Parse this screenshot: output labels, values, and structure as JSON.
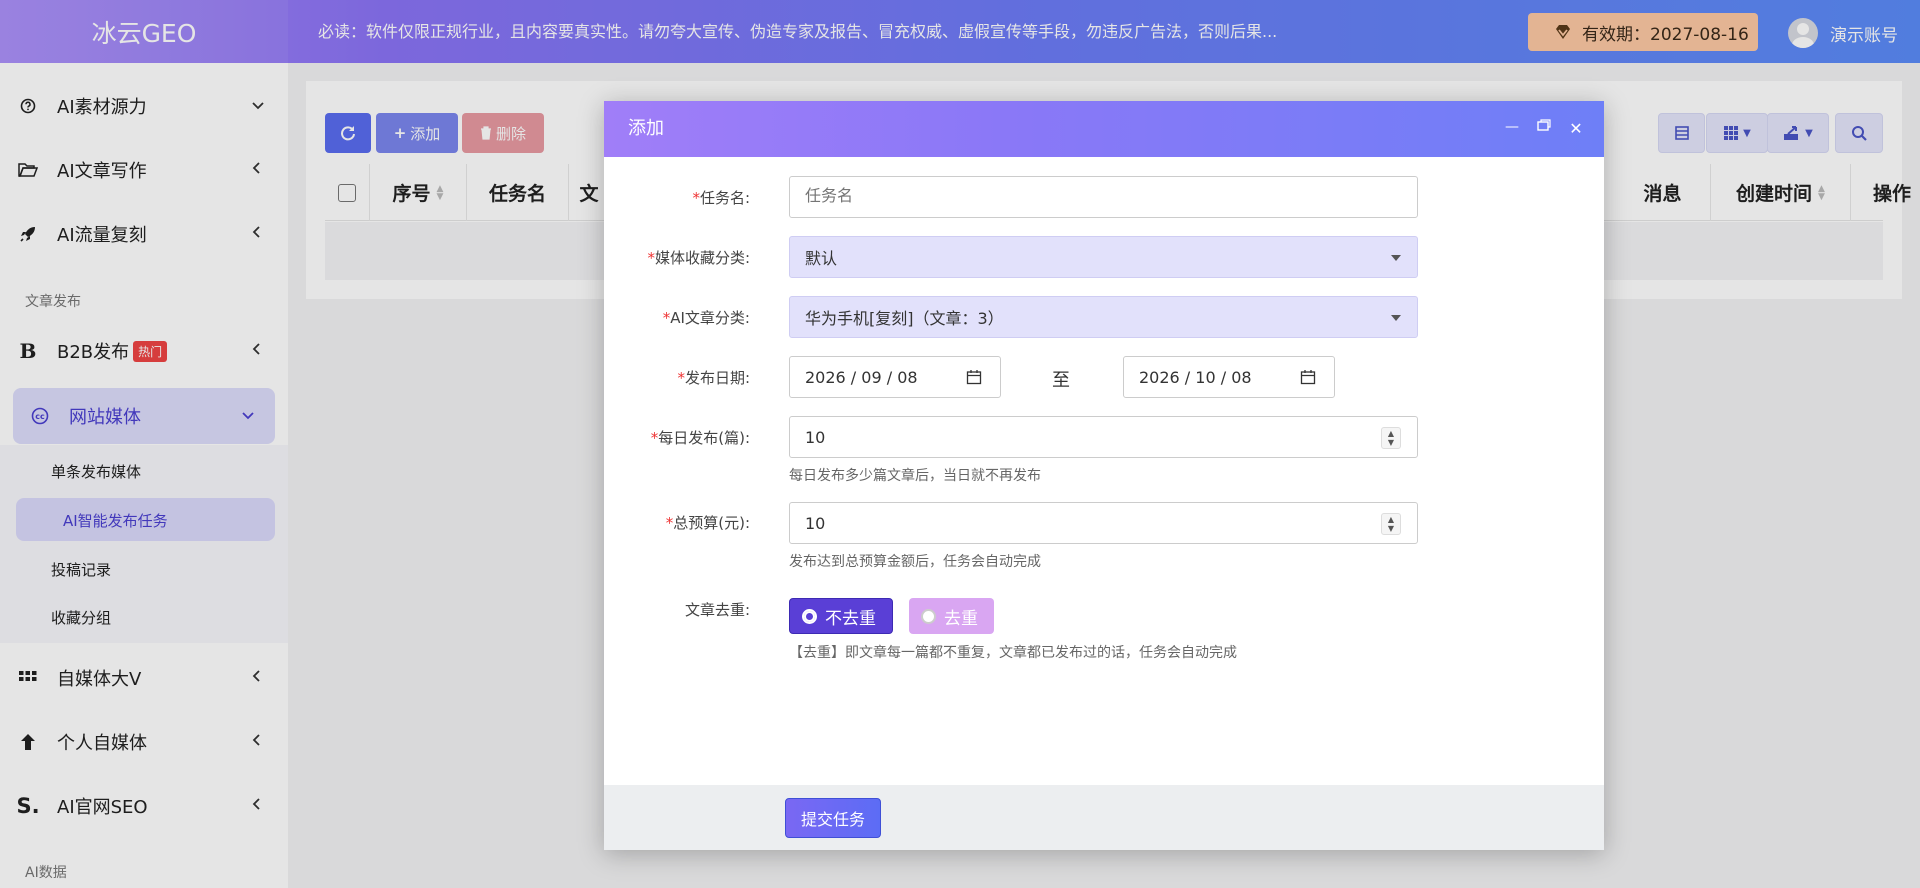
{
  "app": {
    "logo": "冰云GEO",
    "notice": "必读：软件仅限正规行业，且内容要真实性。请勿夸大宣传、伪造专家及报告、冒充权威、虚假宣传等手段，勿违反广告法，否则后果...",
    "expiry": "有效期：2027-08-16",
    "username": "演示账号"
  },
  "sidebar": {
    "items": [
      {
        "label": "AI素材源力",
        "icon": "question-circle-icon"
      },
      {
        "label": "AI文章写作",
        "icon": "folder-open-icon"
      },
      {
        "label": "AI流量复刻",
        "icon": "rocket-icon"
      }
    ],
    "section_publish": "文章发布",
    "b2b": {
      "label": "B2B发布",
      "badge": "热门"
    },
    "website": {
      "label": "网站媒体"
    },
    "subitems": [
      "单条发布媒体",
      "AI智能发布任务",
      "投稿记录",
      "收藏分组"
    ],
    "more": [
      {
        "label": "自媒体大V",
        "icon": "grid-icon"
      },
      {
        "label": "个人自媒体",
        "icon": "arrow-up-icon"
      },
      {
        "label": "AI官网SEO",
        "icon": "seo-s-icon"
      }
    ],
    "section_data": "AI数据"
  },
  "toolbar": {
    "add": "添加",
    "delete": "删除"
  },
  "table": {
    "headers": [
      "序号",
      "任务名",
      "消息",
      "创建时间",
      "操作"
    ],
    "partial_header": "文"
  },
  "dialog": {
    "title": "添加",
    "fields": {
      "task_name": {
        "label": "任务名:",
        "placeholder": "任务名"
      },
      "media_group": {
        "label": "媒体收藏分类:",
        "value": "默认"
      },
      "article_group": {
        "label": "AI文章分类:",
        "value": "华为手机[复刻]（文章：3）"
      },
      "date": {
        "label": "发布日期:",
        "start": "2026 / 09 / 08",
        "sep": "至",
        "end": "2026 / 10 / 08"
      },
      "daily": {
        "label": "每日发布(篇):",
        "value": "10",
        "help": "每日发布多少篇文章后，当日就不再发布"
      },
      "budget": {
        "label": "总预算(元):",
        "value": "10",
        "help": "发布达到总预算金额后，任务会自动完成"
      },
      "dedupe": {
        "label": "文章去重:",
        "options": [
          "不去重",
          "去重"
        ],
        "selected": "不去重",
        "help": "【去重】即文章每一篇都不重复，文章都已发布过的话，任务会自动完成"
      }
    },
    "submit": "提交任务"
  },
  "colors": {
    "accent": "#6b5cf0",
    "brand_gradient_start": "#a78bfa",
    "brand_gradient_end": "#5b8cf8",
    "expiry_bg": "#fdc9a4",
    "delete": "#e88b95"
  }
}
